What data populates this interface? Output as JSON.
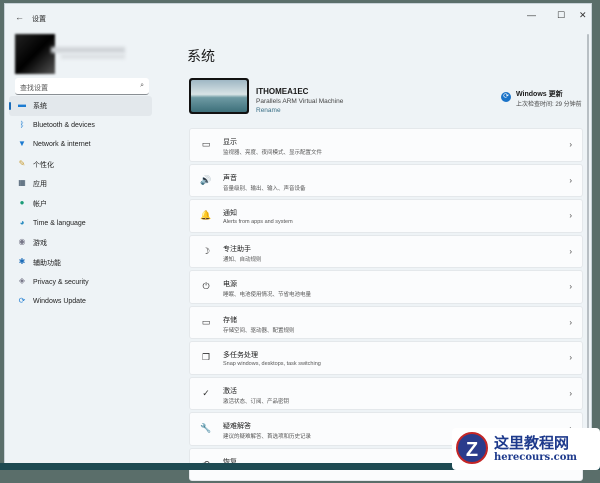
{
  "window": {
    "title": "设置",
    "back": "←",
    "min": "—",
    "max": "☐",
    "close": "✕"
  },
  "search": {
    "placeholder": "查找设置",
    "icon": "⌕"
  },
  "nav": [
    {
      "label": "系统",
      "icon": "▬",
      "color": "#1c7bd1"
    },
    {
      "label": "Bluetooth & devices",
      "icon": "ᛒ",
      "color": "#1c7bd1"
    },
    {
      "label": "Network & internet",
      "icon": "▼",
      "color": "#1c7bd1"
    },
    {
      "label": "个性化",
      "icon": "✎",
      "color": "#c89b30"
    },
    {
      "label": "应用",
      "icon": "▦",
      "color": "#34495e"
    },
    {
      "label": "帐户",
      "icon": "●",
      "color": "#1a9c78"
    },
    {
      "label": "Time & language",
      "icon": "◕",
      "color": "#2a8cc0"
    },
    {
      "label": "游戏",
      "icon": "◉",
      "color": "#778"
    },
    {
      "label": "辅助功能",
      "icon": "✱",
      "color": "#1c6cb8"
    },
    {
      "label": "Privacy & security",
      "icon": "◈",
      "color": "#778"
    },
    {
      "label": "Windows Update",
      "icon": "⟳",
      "color": "#1c7bd1"
    }
  ],
  "page_title": "系统",
  "device": {
    "name": "ITHOMEA1EC",
    "model": "Parallels ARM Virtual Machine",
    "rename": "Rename"
  },
  "update": {
    "title": "Windows 更新",
    "subtitle": "上次检查时间: 29 分钟前",
    "icon": "⟳"
  },
  "cards": [
    {
      "title": "显示",
      "sub": "监视器、亮度、夜间模式、显示配置文件",
      "icon": "▭"
    },
    {
      "title": "声音",
      "sub": "音量级别、输出、输入、声音设备",
      "icon": "🔊"
    },
    {
      "title": "通知",
      "sub": "Alerts from apps and system",
      "icon": "🔔"
    },
    {
      "title": "专注助手",
      "sub": "通知、自动规则",
      "icon": "☽"
    },
    {
      "title": "电源",
      "sub": "睡眠、电池使用情况、节省电池电量",
      "icon": "⏻"
    },
    {
      "title": "存储",
      "sub": "存储空间、驱动器、配置规则",
      "icon": "▭"
    },
    {
      "title": "多任务处理",
      "sub": "Snap windows, desktops, task switching",
      "icon": "❐"
    },
    {
      "title": "激活",
      "sub": "激活状态、订阅、产品密钥",
      "icon": "✓"
    },
    {
      "title": "疑难解答",
      "sub": "建议的疑难解答、首选项和历史记录",
      "icon": "🔧"
    },
    {
      "title": "恢复",
      "sub": "",
      "icon": "⟲"
    }
  ],
  "chevron": "›",
  "watermark": {
    "text": "这里教程网",
    "url": "herecours.com",
    "logo": "Z"
  }
}
